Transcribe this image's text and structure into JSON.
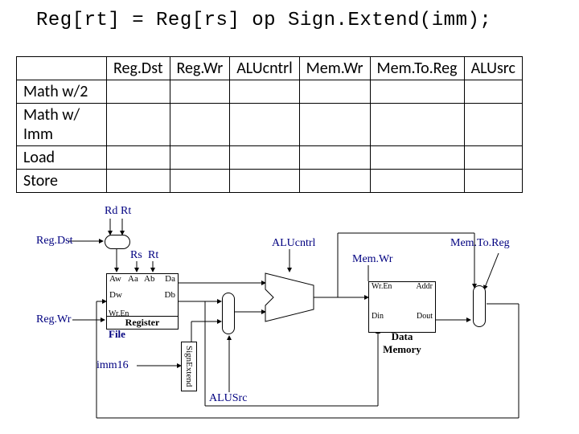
{
  "title": "Reg[rt] = Reg[rs] op Sign.Extend(imm);",
  "table": {
    "headers": [
      "",
      "Reg.Dst",
      "Reg.Wr",
      "ALUcntrl",
      "Mem.Wr",
      "Mem.To.Reg",
      "ALUsrc"
    ],
    "rows": [
      "Math w/2",
      "Math w/ Imm",
      "Load",
      "Store"
    ]
  },
  "diagram": {
    "signals": {
      "rd": "Rd",
      "rt": "Rt",
      "rs": "Rs",
      "rt2": "Rt",
      "regdst": "Reg.Dst",
      "regwr": "Reg.Wr",
      "imm16": "imm16",
      "alucntrl": "ALUcntrl",
      "alusrc": "ALUSrc",
      "memwr": "Mem.Wr",
      "memtoreg": "Mem.To.Reg"
    },
    "blocks": {
      "regfile": "Register File",
      "regports": {
        "aw": "Aw",
        "aa": "Aa",
        "ab": "Ab",
        "da": "Da",
        "dw": "Dw",
        "db": "Db",
        "wren": "Wr.En"
      },
      "signextend": "SignExtend",
      "datamem": "Data Memory",
      "memports": {
        "wren": "Wr.En",
        "addr": "Addr",
        "din": "Din",
        "dout": "Dout"
      }
    }
  }
}
